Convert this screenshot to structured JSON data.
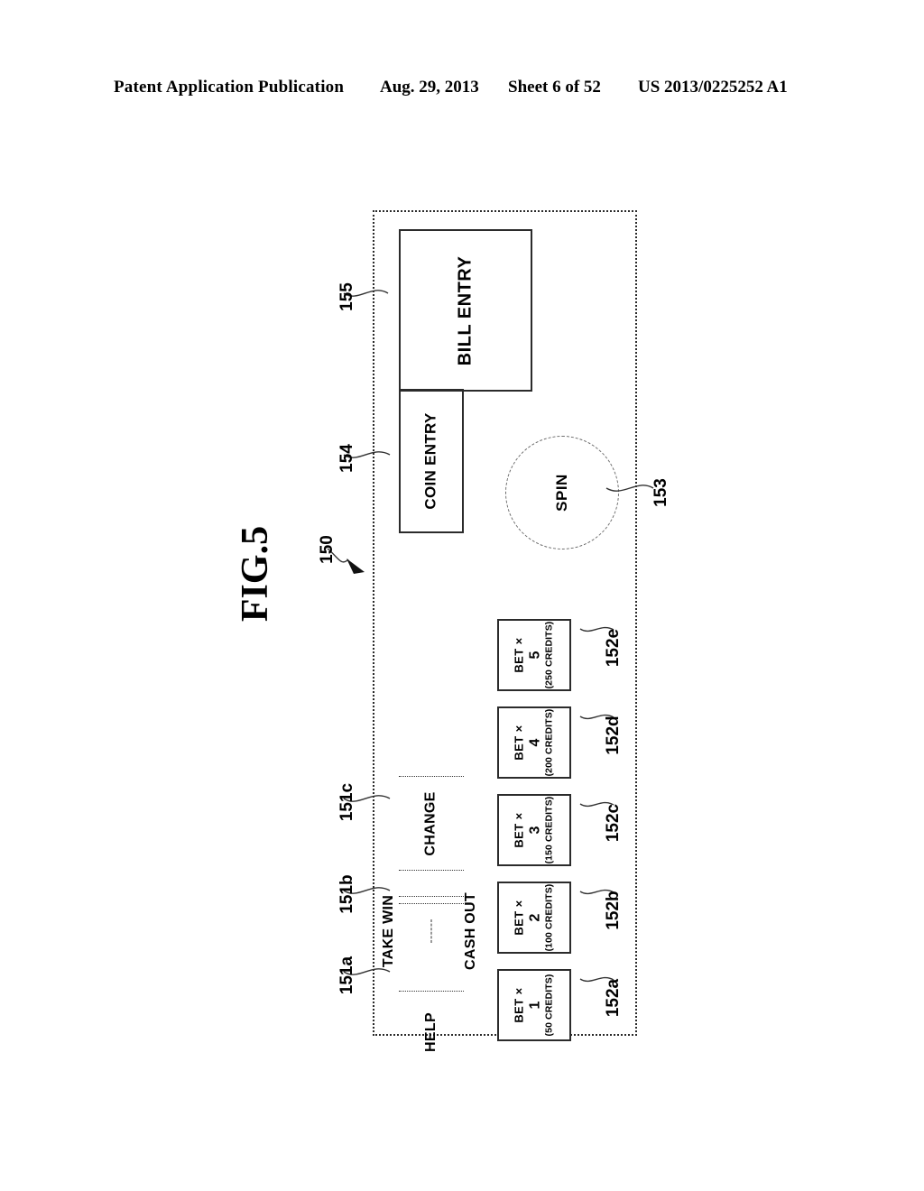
{
  "header": {
    "publication": "Patent Application Publication",
    "date": "Aug. 29, 2013",
    "sheet": "Sheet 6 of 52",
    "publication_number": "US 2013/0225252 A1"
  },
  "figure": {
    "label": "FIG.5",
    "panel_ref": "150"
  },
  "panel": {
    "bill_entry": {
      "label": "BILL ENTRY",
      "ref": "155"
    },
    "coin_entry": {
      "label": "COIN ENTRY",
      "ref": "154"
    },
    "spin": {
      "label": "SPIN",
      "ref": "153"
    },
    "functions": [
      {
        "ref": "151a",
        "labels": [
          "CHANGE"
        ]
      },
      {
        "ref": "151b",
        "labels": [
          "TAKE WIN",
          "CASH OUT"
        ]
      },
      {
        "ref": "151c",
        "labels": [
          "HELP"
        ]
      }
    ],
    "bet_buttons": [
      {
        "ref": "152a",
        "line1": "BET ×",
        "line2": "1",
        "line3": "(50 CREDITS)"
      },
      {
        "ref": "152b",
        "line1": "BET ×",
        "line2": "2",
        "line3": "(100 CREDITS)"
      },
      {
        "ref": "152c",
        "line1": "BET ×",
        "line2": "3",
        "line3": "(150 CREDITS)"
      },
      {
        "ref": "152d",
        "line1": "BET ×",
        "line2": "4",
        "line3": "(200 CREDITS)"
      },
      {
        "ref": "152e",
        "line1": "BET ×",
        "line2": "5",
        "line3": "(250 CREDITS)"
      }
    ]
  },
  "colors": {
    "ink": "#000000",
    "line": "#2b2b2b",
    "dotted": "#333333",
    "background": "#ffffff"
  }
}
